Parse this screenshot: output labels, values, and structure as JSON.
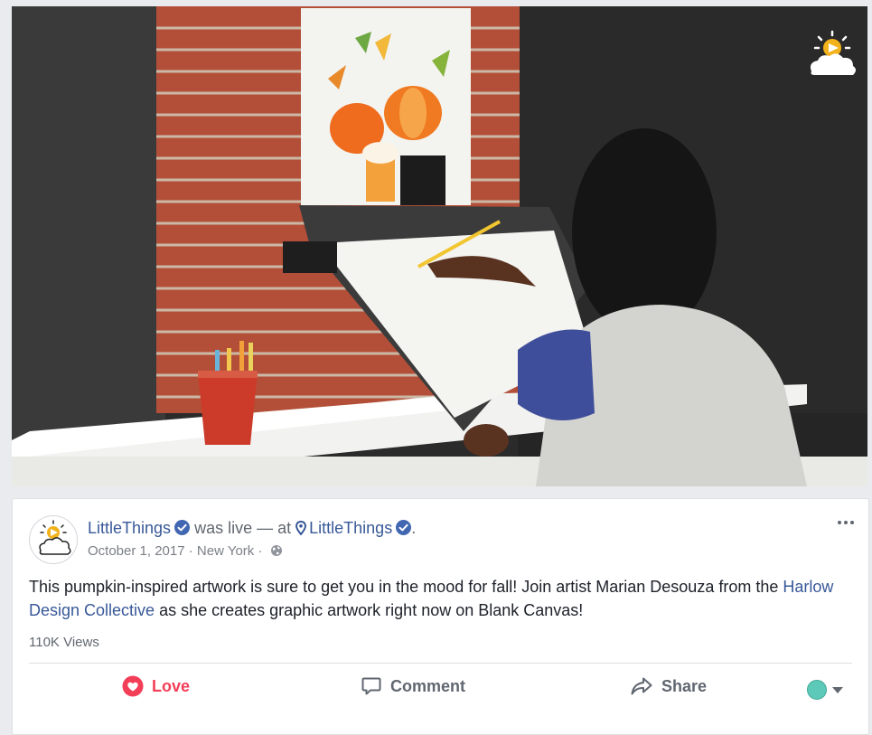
{
  "post": {
    "page_name": "LittleThings",
    "live_text": "was live — at",
    "location_name": "LittleThings",
    "location_suffix": ".",
    "date": "October 1, 2017",
    "separator1": "·",
    "place": "New York",
    "separator2": "·",
    "body_part1": "This pumpkin-inspired artwork is sure to get you in the mood for fall! Join artist Marian Desouza from the ",
    "body_link": "Harlow Design Collective",
    "body_part2": " as she creates graphic artwork right now on Blank Canvas!",
    "views": "110K Views"
  },
  "actions": {
    "love_label": "Love",
    "comment_label": "Comment",
    "share_label": "Share"
  },
  "colors": {
    "link": "#385898",
    "love": "#f33e58",
    "verified": "#4267b2"
  },
  "icons": {
    "verified": "verified-badge-icon",
    "location": "location-pin-icon",
    "privacy": "globe-icon",
    "more": "more-options-icon",
    "love": "heart-icon",
    "comment": "comment-bubble-icon",
    "share": "share-arrow-icon",
    "audience": "audience-selector-icon"
  }
}
